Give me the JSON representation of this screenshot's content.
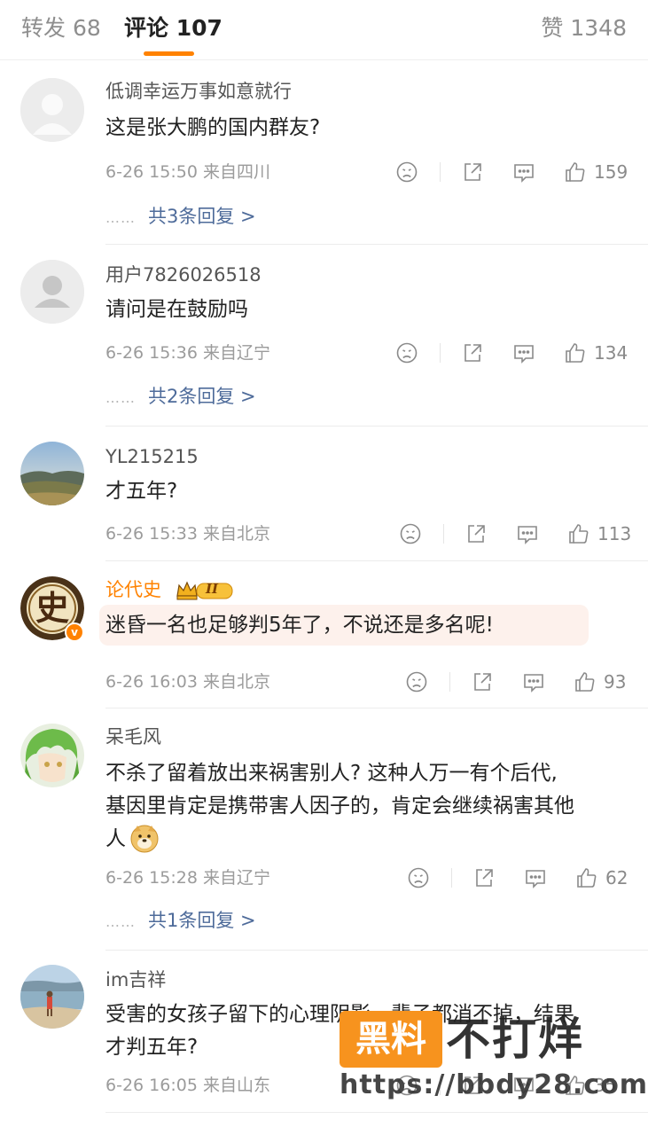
{
  "tabs": {
    "repost": "转发 68",
    "comments": "评论 107",
    "likes": "赞 1348"
  },
  "comments": [
    {
      "name": "低调幸运万事如意就行",
      "text": "这是张大鹏的国内群友?",
      "meta": "6-26 15:50  来自四川",
      "likes": "159",
      "replies": "共3条回复 >"
    },
    {
      "name": "用户7826026518",
      "text": "请问是在鼓励吗",
      "meta": "6-26 15:36  来自辽宁",
      "likes": "134",
      "replies": "共2条回复 >"
    },
    {
      "name": "YL215215",
      "text": "才五年?",
      "meta": "6-26 15:33  来自北京",
      "likes": "113"
    },
    {
      "name": "论代史",
      "crown_level": "II",
      "avatar_char": "史",
      "verified_badge": "v",
      "text": "迷昏一名也足够判5年了，不说还是多名呢!",
      "meta": "6-26 16:03  来自北京",
      "likes": "93"
    },
    {
      "name": "呆毛风",
      "text_lines": [
        "不杀了留着放出来祸害别人? 这种人万一有个后代,",
        "基因里肯定是携带害人因子的，肯定会继续祸害其他",
        "人"
      ],
      "emoji": "doge-emoji",
      "meta": "6-26 15:28  来自辽宁",
      "likes": "62",
      "replies": "共1条回复 >"
    },
    {
      "name": "im吉祥",
      "text_lines": [
        "受害的女孩子留下的心理阴影一辈子都消不掉，结果",
        "才判五年?"
      ],
      "meta": "6-26 16:05  来自山东",
      "likes": "35"
    }
  ],
  "replies_dots": "……",
  "watermark": {
    "box": "黑料",
    "title": "不打烊",
    "url": "https://bbdy28.com"
  },
  "colors": {
    "accent": "#ff8200",
    "link": "#4e6b9a",
    "meta": "#9b9b9b",
    "highlight_bg": "#fdf1ec"
  }
}
